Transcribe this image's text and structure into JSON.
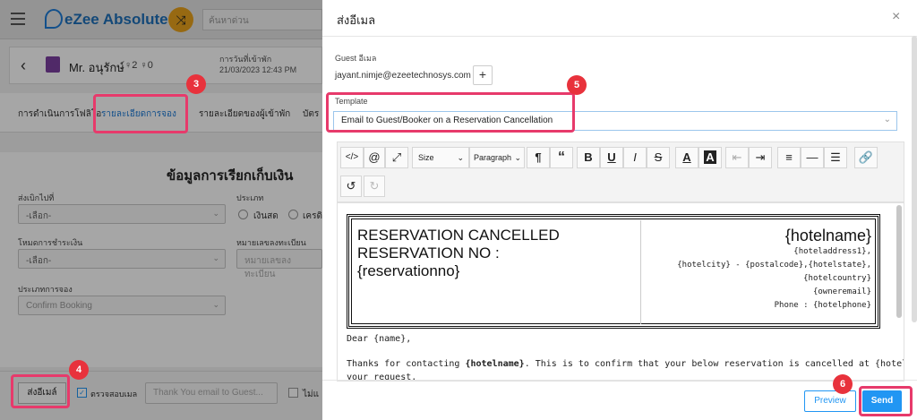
{
  "app": {
    "title": "eZee Absolute",
    "search_placeholder": "ค้นหาด่วน",
    "guest_name": "Mr. อนุรักษ์",
    "adults": "2",
    "children": "0",
    "checkin_label": "การวันที่เข้าพัก",
    "checkin_value": "21/03/2023 12:43 PM",
    "tabs": [
      "การดำเนินการโฟลิโอ",
      "รายละเอียดการจอง",
      "รายละเอียดของผู้เข้าพัก",
      "บัตร"
    ],
    "section_title": "ข้อมูลการเรียกเก็บเงิน",
    "send_to_label": "ส่งเบิกไปที่",
    "send_to_value": "-เลือก-",
    "type_label": "ประเภท",
    "type_opt1": "เงินสด",
    "type_opt2": "เครดิ",
    "payment_label": "โหมดการชำระเงิน",
    "payment_value": "-เลือก-",
    "regno_label": "หมายเลขลงทะเบียน",
    "regno_placeholder": "หมายเลขลงทะเบียน",
    "booking_type_label": "ประเภทการจอง",
    "booking_type_value": "Confirm Booking",
    "send_email_button": "ส่งอีเมล์",
    "checkbox1_label": "ตรวจสอบเมล",
    "thank_you_placeholder": "Thank You email to Guest...",
    "checkbox2_label": "ไม่แ"
  },
  "modal": {
    "title": "ส่งอีเมล",
    "guest_email_label": "Guest อีเมล",
    "guest_email": "jayant.nimje@ezeetechnosys.com",
    "add_label": "+",
    "template_label": "Template",
    "template_value": "Email to Guest/Booker on a Reservation Cancellation",
    "toolbar": {
      "size": "Size",
      "paragraph": "Paragraph"
    },
    "email": {
      "heading_line1": "RESERVATION CANCELLED",
      "heading_line2": "RESERVATION NO :",
      "heading_line3": "{reservationno}",
      "hotelname": "{hotelname}",
      "address_lines": [
        "{hoteladdress1},",
        "{hotelcity} - {postalcode},{hotelstate},",
        "{hotelcountry}",
        "{owneremail}",
        "Phone : {hotelphone}"
      ],
      "greeting": "Dear {name},",
      "body_prefix": "Thanks for contacting ",
      "body_bold": "{hotelname}",
      "body_suffix": ". This is to confirm that your below reservation is cancelled at {hotelname} as per",
      "body_line2": "your request."
    },
    "preview_button": "Preview",
    "send_button": "Send"
  },
  "badges": [
    "3",
    "4",
    "5",
    "6"
  ],
  "colors": {
    "accent": "#2196f3",
    "highlight": "#e73a6b",
    "badge": "#e8323c"
  }
}
